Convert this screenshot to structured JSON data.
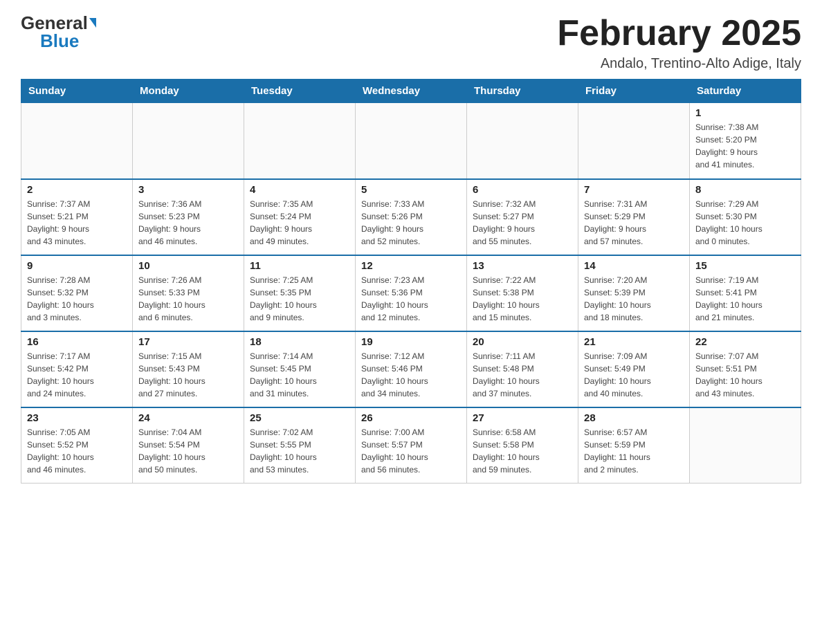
{
  "header": {
    "logo_general": "General",
    "logo_blue": "Blue",
    "month_title": "February 2025",
    "location": "Andalo, Trentino-Alto Adige, Italy"
  },
  "weekdays": [
    "Sunday",
    "Monday",
    "Tuesday",
    "Wednesday",
    "Thursday",
    "Friday",
    "Saturday"
  ],
  "weeks": [
    [
      {
        "day": "",
        "info": ""
      },
      {
        "day": "",
        "info": ""
      },
      {
        "day": "",
        "info": ""
      },
      {
        "day": "",
        "info": ""
      },
      {
        "day": "",
        "info": ""
      },
      {
        "day": "",
        "info": ""
      },
      {
        "day": "1",
        "info": "Sunrise: 7:38 AM\nSunset: 5:20 PM\nDaylight: 9 hours\nand 41 minutes."
      }
    ],
    [
      {
        "day": "2",
        "info": "Sunrise: 7:37 AM\nSunset: 5:21 PM\nDaylight: 9 hours\nand 43 minutes."
      },
      {
        "day": "3",
        "info": "Sunrise: 7:36 AM\nSunset: 5:23 PM\nDaylight: 9 hours\nand 46 minutes."
      },
      {
        "day": "4",
        "info": "Sunrise: 7:35 AM\nSunset: 5:24 PM\nDaylight: 9 hours\nand 49 minutes."
      },
      {
        "day": "5",
        "info": "Sunrise: 7:33 AM\nSunset: 5:26 PM\nDaylight: 9 hours\nand 52 minutes."
      },
      {
        "day": "6",
        "info": "Sunrise: 7:32 AM\nSunset: 5:27 PM\nDaylight: 9 hours\nand 55 minutes."
      },
      {
        "day": "7",
        "info": "Sunrise: 7:31 AM\nSunset: 5:29 PM\nDaylight: 9 hours\nand 57 minutes."
      },
      {
        "day": "8",
        "info": "Sunrise: 7:29 AM\nSunset: 5:30 PM\nDaylight: 10 hours\nand 0 minutes."
      }
    ],
    [
      {
        "day": "9",
        "info": "Sunrise: 7:28 AM\nSunset: 5:32 PM\nDaylight: 10 hours\nand 3 minutes."
      },
      {
        "day": "10",
        "info": "Sunrise: 7:26 AM\nSunset: 5:33 PM\nDaylight: 10 hours\nand 6 minutes."
      },
      {
        "day": "11",
        "info": "Sunrise: 7:25 AM\nSunset: 5:35 PM\nDaylight: 10 hours\nand 9 minutes."
      },
      {
        "day": "12",
        "info": "Sunrise: 7:23 AM\nSunset: 5:36 PM\nDaylight: 10 hours\nand 12 minutes."
      },
      {
        "day": "13",
        "info": "Sunrise: 7:22 AM\nSunset: 5:38 PM\nDaylight: 10 hours\nand 15 minutes."
      },
      {
        "day": "14",
        "info": "Sunrise: 7:20 AM\nSunset: 5:39 PM\nDaylight: 10 hours\nand 18 minutes."
      },
      {
        "day": "15",
        "info": "Sunrise: 7:19 AM\nSunset: 5:41 PM\nDaylight: 10 hours\nand 21 minutes."
      }
    ],
    [
      {
        "day": "16",
        "info": "Sunrise: 7:17 AM\nSunset: 5:42 PM\nDaylight: 10 hours\nand 24 minutes."
      },
      {
        "day": "17",
        "info": "Sunrise: 7:15 AM\nSunset: 5:43 PM\nDaylight: 10 hours\nand 27 minutes."
      },
      {
        "day": "18",
        "info": "Sunrise: 7:14 AM\nSunset: 5:45 PM\nDaylight: 10 hours\nand 31 minutes."
      },
      {
        "day": "19",
        "info": "Sunrise: 7:12 AM\nSunset: 5:46 PM\nDaylight: 10 hours\nand 34 minutes."
      },
      {
        "day": "20",
        "info": "Sunrise: 7:11 AM\nSunset: 5:48 PM\nDaylight: 10 hours\nand 37 minutes."
      },
      {
        "day": "21",
        "info": "Sunrise: 7:09 AM\nSunset: 5:49 PM\nDaylight: 10 hours\nand 40 minutes."
      },
      {
        "day": "22",
        "info": "Sunrise: 7:07 AM\nSunset: 5:51 PM\nDaylight: 10 hours\nand 43 minutes."
      }
    ],
    [
      {
        "day": "23",
        "info": "Sunrise: 7:05 AM\nSunset: 5:52 PM\nDaylight: 10 hours\nand 46 minutes."
      },
      {
        "day": "24",
        "info": "Sunrise: 7:04 AM\nSunset: 5:54 PM\nDaylight: 10 hours\nand 50 minutes."
      },
      {
        "day": "25",
        "info": "Sunrise: 7:02 AM\nSunset: 5:55 PM\nDaylight: 10 hours\nand 53 minutes."
      },
      {
        "day": "26",
        "info": "Sunrise: 7:00 AM\nSunset: 5:57 PM\nDaylight: 10 hours\nand 56 minutes."
      },
      {
        "day": "27",
        "info": "Sunrise: 6:58 AM\nSunset: 5:58 PM\nDaylight: 10 hours\nand 59 minutes."
      },
      {
        "day": "28",
        "info": "Sunrise: 6:57 AM\nSunset: 5:59 PM\nDaylight: 11 hours\nand 2 minutes."
      },
      {
        "day": "",
        "info": ""
      }
    ]
  ]
}
